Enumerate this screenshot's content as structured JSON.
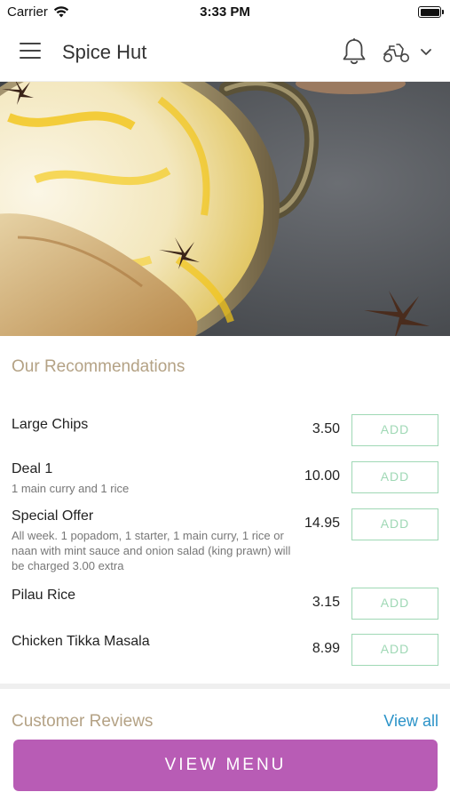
{
  "status_bar": {
    "carrier": "Carrier",
    "time": "3:33 PM"
  },
  "header": {
    "title": "Spice Hut"
  },
  "recommendations": {
    "title": "Our Recommendations",
    "add_label": "ADD",
    "items": [
      {
        "name": "Large Chips",
        "description": "",
        "price": "3.50"
      },
      {
        "name": "Deal 1",
        "description": "1 main curry and 1 rice",
        "price": "10.00"
      },
      {
        "name": "Special Offer",
        "description": "All week. 1 popadom, 1 starter, 1 main curry, 1 rice or naan with mint sauce and onion salad (king prawn) will be charged 3.00 extra",
        "price": "14.95"
      },
      {
        "name": "Pilau Rice",
        "description": "",
        "price": "3.15"
      },
      {
        "name": "Chicken Tikka Masala",
        "description": "",
        "price": "8.99"
      }
    ]
  },
  "reviews": {
    "title": "Customer Reviews",
    "view_all": "View all"
  },
  "footer": {
    "view_menu": "VIEW MENU"
  },
  "colors": {
    "accent_purple": "#b85cb5",
    "add_green": "#9fd8b5",
    "section_gold": "#b4a285",
    "link_blue": "#2b93c8"
  }
}
